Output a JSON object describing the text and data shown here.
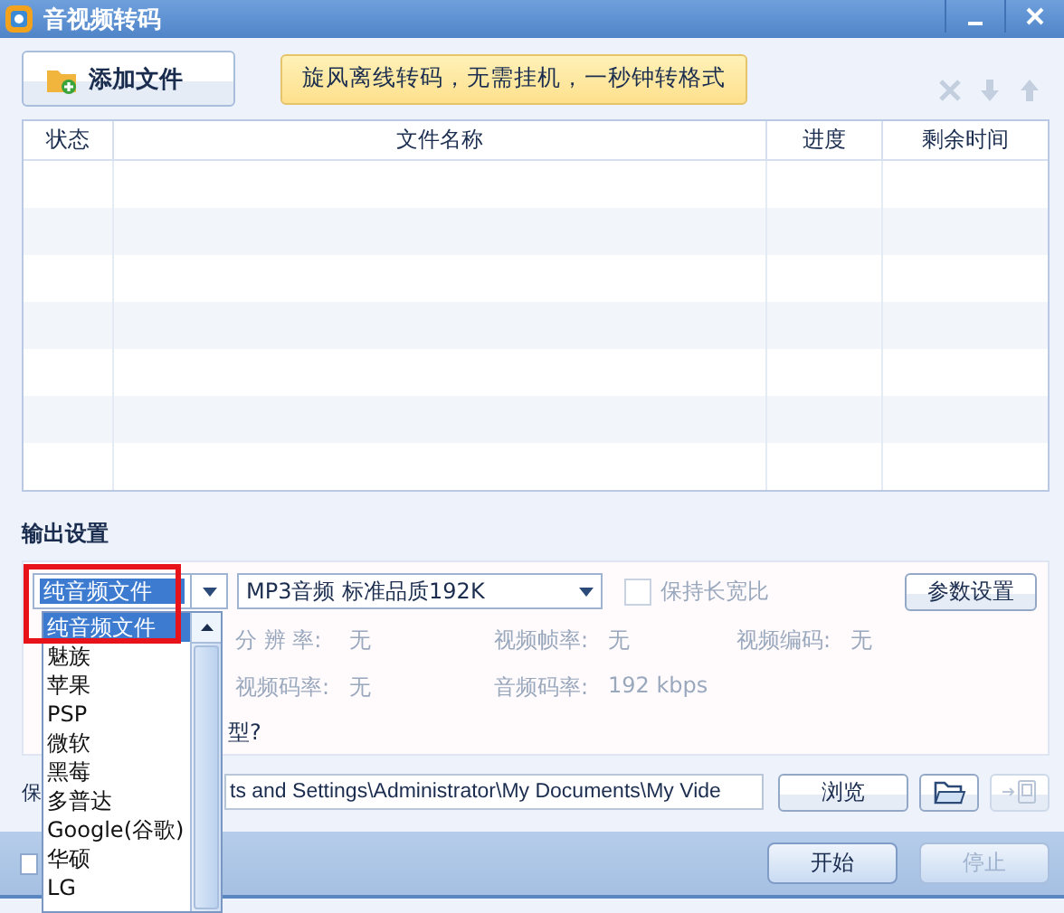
{
  "window": {
    "title": "音视频转码"
  },
  "toolbar": {
    "add_button": "添加文件",
    "banner": "旋风离线转码，无需挂机，一秒钟转格式",
    "actions": [
      {
        "kind": "delete",
        "disabled": true
      },
      {
        "kind": "down",
        "disabled": true
      },
      {
        "kind": "up",
        "disabled": true
      }
    ]
  },
  "table": {
    "columns": [
      "状态",
      "文件名称",
      "进度",
      "剩余时间"
    ]
  },
  "output_settings": {
    "heading": "输出设置",
    "category": {
      "value": "纯音频文件",
      "highlighted": true
    },
    "preset": {
      "value": "MP3音频 标准品质192K"
    },
    "keep_aspect": {
      "label": "保持长宽比",
      "checked": false,
      "disabled": true
    },
    "params_button": "参数设置",
    "info": [
      {
        "label": "分 辨 率:",
        "value": "无"
      },
      {
        "label": "视频帧率:",
        "value": "无"
      },
      {
        "label": "视频编码:",
        "value": "无"
      },
      {
        "label": "视频码率:",
        "value": "无"
      },
      {
        "label": "音频码率:",
        "value": "192 kbps"
      }
    ],
    "hint_fragment": "型?"
  },
  "save": {
    "label_fragment": "保",
    "path": "ts and Settings\\Administrator\\My Documents\\My Vide",
    "browse_button": "浏览",
    "device_disabled": true
  },
  "footer": {
    "checked": false,
    "start_button": {
      "label": "开始",
      "disabled": false
    },
    "stop_button": {
      "label": "停止",
      "disabled": true
    }
  },
  "dropdown": {
    "items": [
      {
        "label": "纯音频文件",
        "selected": true
      },
      {
        "label": "魅族",
        "selected": false
      },
      {
        "label": "苹果",
        "selected": false
      },
      {
        "label": "PSP",
        "selected": false
      },
      {
        "label": "微软",
        "selected": false
      },
      {
        "label": "黑莓",
        "selected": false
      },
      {
        "label": "多普达",
        "selected": false
      },
      {
        "label": "Google(谷歌)",
        "selected": false
      },
      {
        "label": "华硕",
        "selected": false
      },
      {
        "label": "LG",
        "selected": false
      }
    ]
  }
}
